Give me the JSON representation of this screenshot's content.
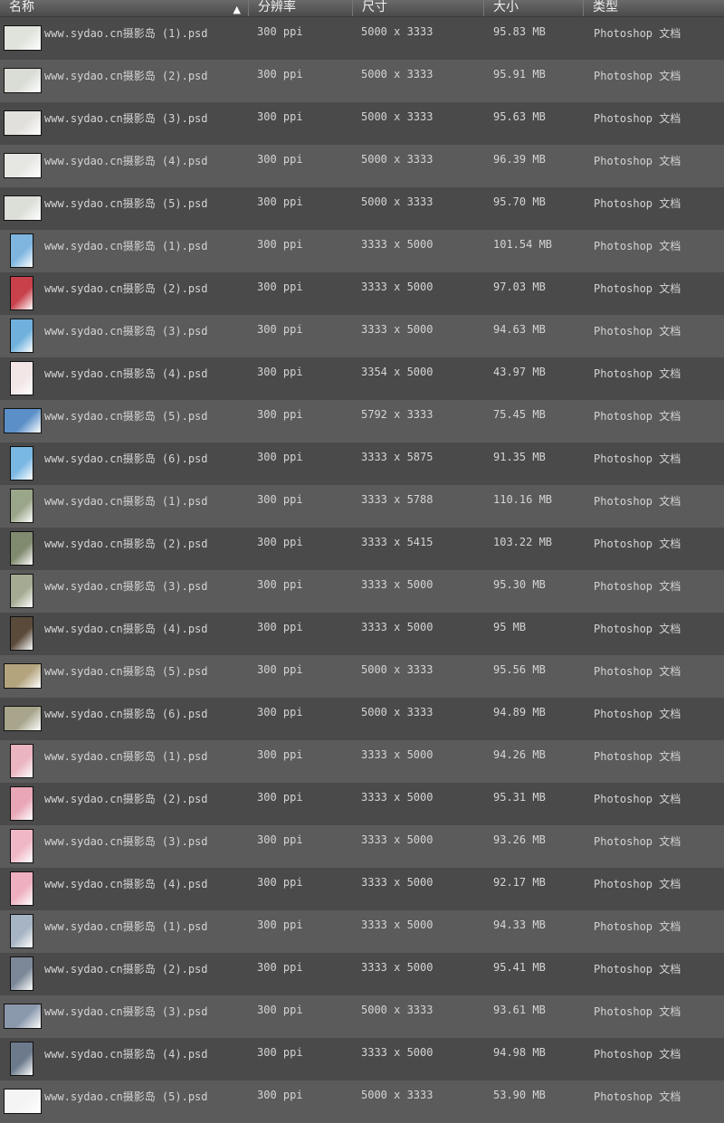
{
  "header": {
    "columns": [
      "名称",
      "分辨率",
      "尺寸",
      "大小",
      "类型"
    ],
    "sort_icon": "chevron-up-icon"
  },
  "rows": [
    {
      "name": "www.sydao.cn摄影岛 (1).psd",
      "res": "300 ppi",
      "dims": "5000 x 3333",
      "size": "95.83 MB",
      "type": "Photoshop 文档",
      "thumb": "landscape",
      "color": "#dfe3dc"
    },
    {
      "name": "www.sydao.cn摄影岛 (2).psd",
      "res": "300 ppi",
      "dims": "5000 x 3333",
      "size": "95.91 MB",
      "type": "Photoshop 文档",
      "thumb": "landscape",
      "color": "#d9ddd5"
    },
    {
      "name": "www.sydao.cn摄影岛 (3).psd",
      "res": "300 ppi",
      "dims": "5000 x 3333",
      "size": "95.63 MB",
      "type": "Photoshop 文档",
      "thumb": "landscape",
      "color": "#e2e0dc"
    },
    {
      "name": "www.sydao.cn摄影岛 (4).psd",
      "res": "300 ppi",
      "dims": "5000 x 3333",
      "size": "96.39 MB",
      "type": "Photoshop 文档",
      "thumb": "landscape",
      "color": "#e6e6e2"
    },
    {
      "name": "www.sydao.cn摄影岛 (5).psd",
      "res": "300 ppi",
      "dims": "5000 x 3333",
      "size": "95.70 MB",
      "type": "Photoshop 文档",
      "thumb": "landscape",
      "color": "#dcdfd8"
    },
    {
      "name": "www.sydao.cn摄影岛 (1).psd",
      "res": "300 ppi",
      "dims": "3333 x 5000",
      "size": "101.54 MB",
      "type": "Photoshop 文档",
      "thumb": "portrait",
      "color": "#7fb6e0"
    },
    {
      "name": "www.sydao.cn摄影岛 (2).psd",
      "res": "300 ppi",
      "dims": "3333 x 5000",
      "size": "97.03 MB",
      "type": "Photoshop 文档",
      "thumb": "portrait",
      "color": "#c8404a"
    },
    {
      "name": "www.sydao.cn摄影岛 (3).psd",
      "res": "300 ppi",
      "dims": "3333 x 5000",
      "size": "94.63 MB",
      "type": "Photoshop 文档",
      "thumb": "portrait",
      "color": "#6fb0dc"
    },
    {
      "name": "www.sydao.cn摄影岛 (4).psd",
      "res": "300 ppi",
      "dims": "3354 x 5000",
      "size": "43.97 MB",
      "type": "Photoshop 文档",
      "thumb": "portrait",
      "color": "#f2e6e6"
    },
    {
      "name": "www.sydao.cn摄影岛 (5).psd",
      "res": "300 ppi",
      "dims": "5792 x 3333",
      "size": "75.45 MB",
      "type": "Photoshop 文档",
      "thumb": "landscape",
      "color": "#5a8fc8"
    },
    {
      "name": "www.sydao.cn摄影岛 (6).psd",
      "res": "300 ppi",
      "dims": "3333 x 5875",
      "size": "91.35 MB",
      "type": "Photoshop 文档",
      "thumb": "portrait",
      "color": "#7ab8e4"
    },
    {
      "name": "www.sydao.cn摄影岛 (1).psd",
      "res": "300 ppi",
      "dims": "3333 x 5788",
      "size": "110.16 MB",
      "type": "Photoshop 文档",
      "thumb": "portrait",
      "color": "#9aa68a"
    },
    {
      "name": "www.sydao.cn摄影岛 (2).psd",
      "res": "300 ppi",
      "dims": "3333 x 5415",
      "size": "103.22 MB",
      "type": "Photoshop 文档",
      "thumb": "portrait",
      "color": "#7f8a6e"
    },
    {
      "name": "www.sydao.cn摄影岛 (3).psd",
      "res": "300 ppi",
      "dims": "3333 x 5000",
      "size": "95.30 MB",
      "type": "Photoshop 文档",
      "thumb": "portrait",
      "color": "#a4ab92"
    },
    {
      "name": "www.sydao.cn摄影岛 (4).psd",
      "res": "300 ppi",
      "dims": "3333 x 5000",
      "size": "95 MB",
      "type": "Photoshop 文档",
      "thumb": "portrait",
      "color": "#5a4a3a"
    },
    {
      "name": "www.sydao.cn摄影岛 (5).psd",
      "res": "300 ppi",
      "dims": "5000 x 3333",
      "size": "95.56 MB",
      "type": "Photoshop 文档",
      "thumb": "landscape",
      "color": "#b3a47e"
    },
    {
      "name": "www.sydao.cn摄影岛 (6).psd",
      "res": "300 ppi",
      "dims": "5000 x 3333",
      "size": "94.89 MB",
      "type": "Photoshop 文档",
      "thumb": "landscape",
      "color": "#a8a58c"
    },
    {
      "name": "www.sydao.cn摄影岛 (1).psd",
      "res": "300 ppi",
      "dims": "3333 x 5000",
      "size": "94.26 MB",
      "type": "Photoshop 文档",
      "thumb": "portrait",
      "color": "#eab4c0"
    },
    {
      "name": "www.sydao.cn摄影岛 (2).psd",
      "res": "300 ppi",
      "dims": "3333 x 5000",
      "size": "95.31 MB",
      "type": "Photoshop 文档",
      "thumb": "portrait",
      "color": "#e8a6b6"
    },
    {
      "name": "www.sydao.cn摄影岛 (3).psd",
      "res": "300 ppi",
      "dims": "3333 x 5000",
      "size": "93.26 MB",
      "type": "Photoshop 文档",
      "thumb": "portrait",
      "color": "#f0b8c6"
    },
    {
      "name": "www.sydao.cn摄影岛 (4).psd",
      "res": "300 ppi",
      "dims": "3333 x 5000",
      "size": "92.17 MB",
      "type": "Photoshop 文档",
      "thumb": "portrait",
      "color": "#eeb0c0"
    },
    {
      "name": "www.sydao.cn摄影岛 (1).psd",
      "res": "300 ppi",
      "dims": "3333 x 5000",
      "size": "94.33 MB",
      "type": "Photoshop 文档",
      "thumb": "portrait",
      "color": "#a7b4c4"
    },
    {
      "name": "www.sydao.cn摄影岛 (2).psd",
      "res": "300 ppi",
      "dims": "3333 x 5000",
      "size": "95.41 MB",
      "type": "Photoshop 文档",
      "thumb": "portrait",
      "color": "#7c8898"
    },
    {
      "name": "www.sydao.cn摄影岛 (3).psd",
      "res": "300 ppi",
      "dims": "5000 x 3333",
      "size": "93.61 MB",
      "type": "Photoshop 文档",
      "thumb": "landscape",
      "color": "#8a98ac"
    },
    {
      "name": "www.sydao.cn摄影岛 (4).psd",
      "res": "300 ppi",
      "dims": "3333 x 5000",
      "size": "94.98 MB",
      "type": "Photoshop 文档",
      "thumb": "portrait",
      "color": "#6c7a8c"
    },
    {
      "name": "www.sydao.cn摄影岛 (5).psd",
      "res": "300 ppi",
      "dims": "5000 x 3333",
      "size": "53.90 MB",
      "type": "Photoshop 文档",
      "thumb": "landscape",
      "color": "#f4f4f4"
    }
  ]
}
